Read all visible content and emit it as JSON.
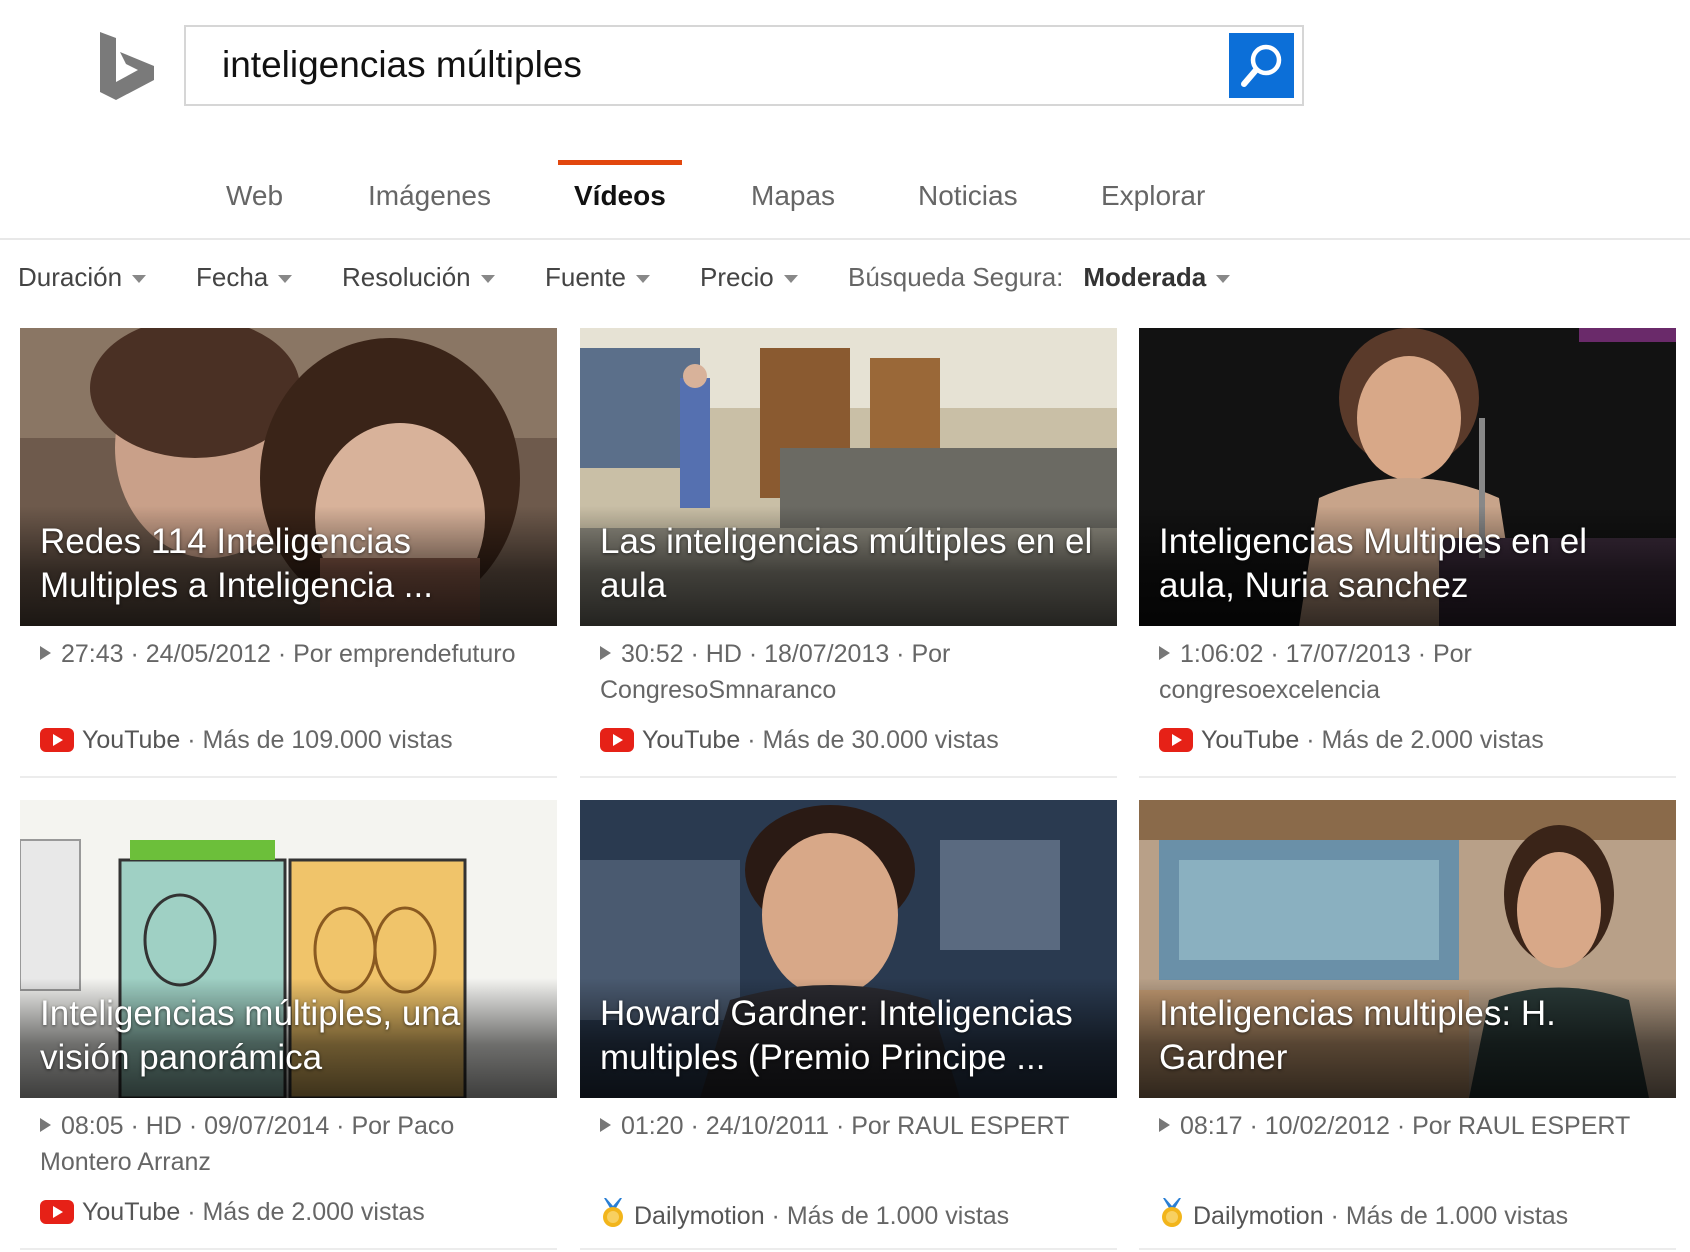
{
  "search": {
    "query": "inteligencias múltiples"
  },
  "scopes": [
    {
      "label": "Web"
    },
    {
      "label": "Imágenes"
    },
    {
      "label": "Vídeos",
      "active": true
    },
    {
      "label": "Mapas"
    },
    {
      "label": "Noticias"
    },
    {
      "label": "Explorar"
    }
  ],
  "filters": {
    "duration": "Duración",
    "date": "Fecha",
    "resolution": "Resolución",
    "source": "Fuente",
    "price": "Precio",
    "safe_search_label": "Búsqueda Segura:",
    "safe_search_value": "Moderada"
  },
  "colors": {
    "accent": "#e2470e",
    "search_button": "#0c6fd8",
    "youtube": "#e62117"
  },
  "videos": [
    {
      "title": "Redes 114 Inteligencias Multiples a Inteligencia ...",
      "meta": "27:43 · 24/05/2012 · Por emprendefuturo",
      "source": "YouTube",
      "views": " · Más de 109.000 vistas",
      "source_icon": "youtube-icon"
    },
    {
      "title": "Las inteligencias múltiples en el aula",
      "meta": "30:52 · HD · 18/07/2013 · Por CongresoSmnaranco",
      "source": "YouTube",
      "views": " · Más de 30.000 vistas",
      "source_icon": "youtube-icon"
    },
    {
      "title": "Inteligencias Multiples en el aula, Nuria sanchez",
      "meta": "1:06:02 · 17/07/2013 · Por congresoexcelencia",
      "source": "YouTube",
      "views": " · Más de 2.000 vistas",
      "source_icon": "youtube-icon"
    },
    {
      "title": "Inteligencias múltiples, una visión panorámica",
      "meta": "08:05 · HD · 09/07/2014 · Por Paco Montero Arranz",
      "source": "YouTube",
      "views": " · Más de 2.000 vistas",
      "source_icon": "youtube-icon"
    },
    {
      "title": "Howard Gardner: Inteligencias multiples (Premio Principe ...",
      "meta": "01:20 · 24/10/2011 · Por RAUL ESPERT",
      "source": "Dailymotion",
      "views": " · Más de 1.000 vistas",
      "source_icon": "dailymotion-icon"
    },
    {
      "title": "Inteligencias multiples: H. Gardner",
      "meta": "08:17 · 10/02/2012 · Por RAUL ESPERT",
      "source": "Dailymotion",
      "views": " · Más de 1.000 vistas",
      "source_icon": "dailymotion-icon"
    }
  ]
}
